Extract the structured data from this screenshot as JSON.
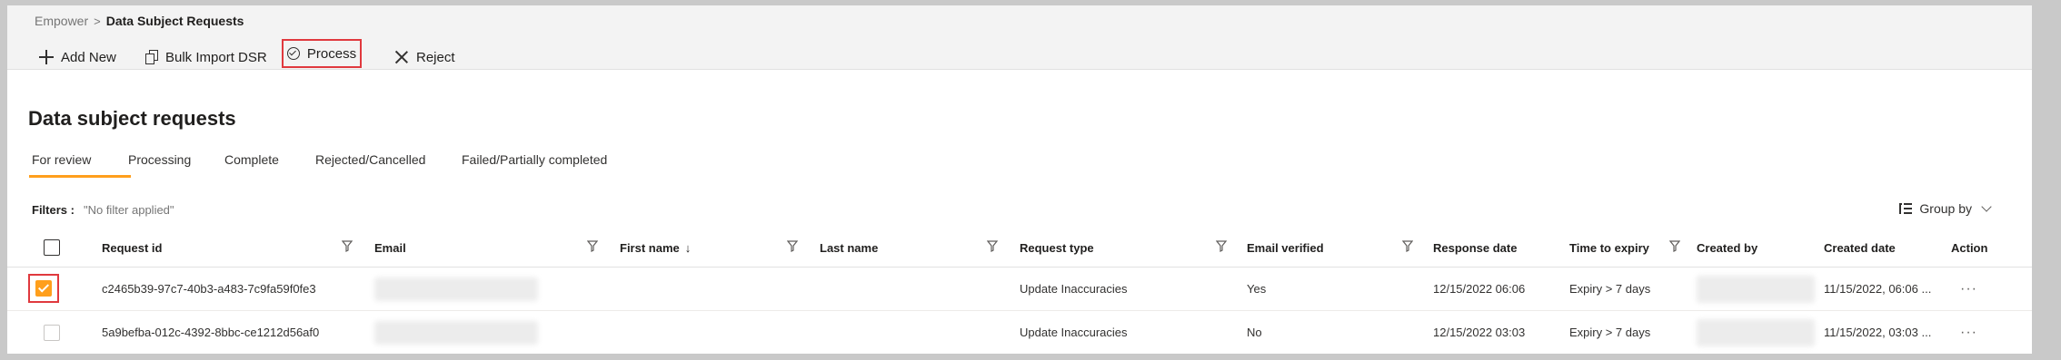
{
  "breadcrumb": {
    "root": "Empower",
    "separator": ">",
    "current": "Data Subject Requests"
  },
  "toolbar": {
    "add_new": "Add New",
    "bulk_import": "Bulk Import DSR",
    "process": "Process",
    "reject": "Reject"
  },
  "page_title": "Data subject requests",
  "tabs": [
    "For review",
    "Processing",
    "Complete",
    "Rejected/Cancelled",
    "Failed/Partially completed"
  ],
  "active_tab": "For review",
  "filters": {
    "label": "Filters :",
    "value": "\"No filter applied\""
  },
  "group_by": "Group by",
  "columns": {
    "request_id": "Request id",
    "email": "Email",
    "first_name": "First name",
    "first_name_sort": "↓",
    "last_name": "Last name",
    "request_type": "Request type",
    "email_verified": "Email verified",
    "response_date": "Response date",
    "time_to_expiry": "Time to expiry",
    "created_by": "Created by",
    "created_date": "Created date",
    "action": "Action"
  },
  "rows": [
    {
      "checked": true,
      "request_id": "c2465b39-97c7-40b3-a483-7c9fa59f0fe3",
      "request_type": "Update Inaccuracies",
      "email_verified": "Yes",
      "response_date": "12/15/2022 06:06",
      "time_to_expiry": "Expiry > 7 days",
      "created_date": "11/15/2022, 06:06 ...",
      "action": "···"
    },
    {
      "checked": false,
      "request_id": "5a9befba-012c-4392-8bbc-ce1212d56af0",
      "request_type": "Update Inaccuracies",
      "email_verified": "No",
      "response_date": "12/15/2022 03:03",
      "time_to_expiry": "Expiry > 7 days",
      "created_date": "11/15/2022, 03:03 ...",
      "action": "···"
    }
  ],
  "colors": {
    "accent": "#ff9f1c",
    "highlight": "#e0393e"
  }
}
